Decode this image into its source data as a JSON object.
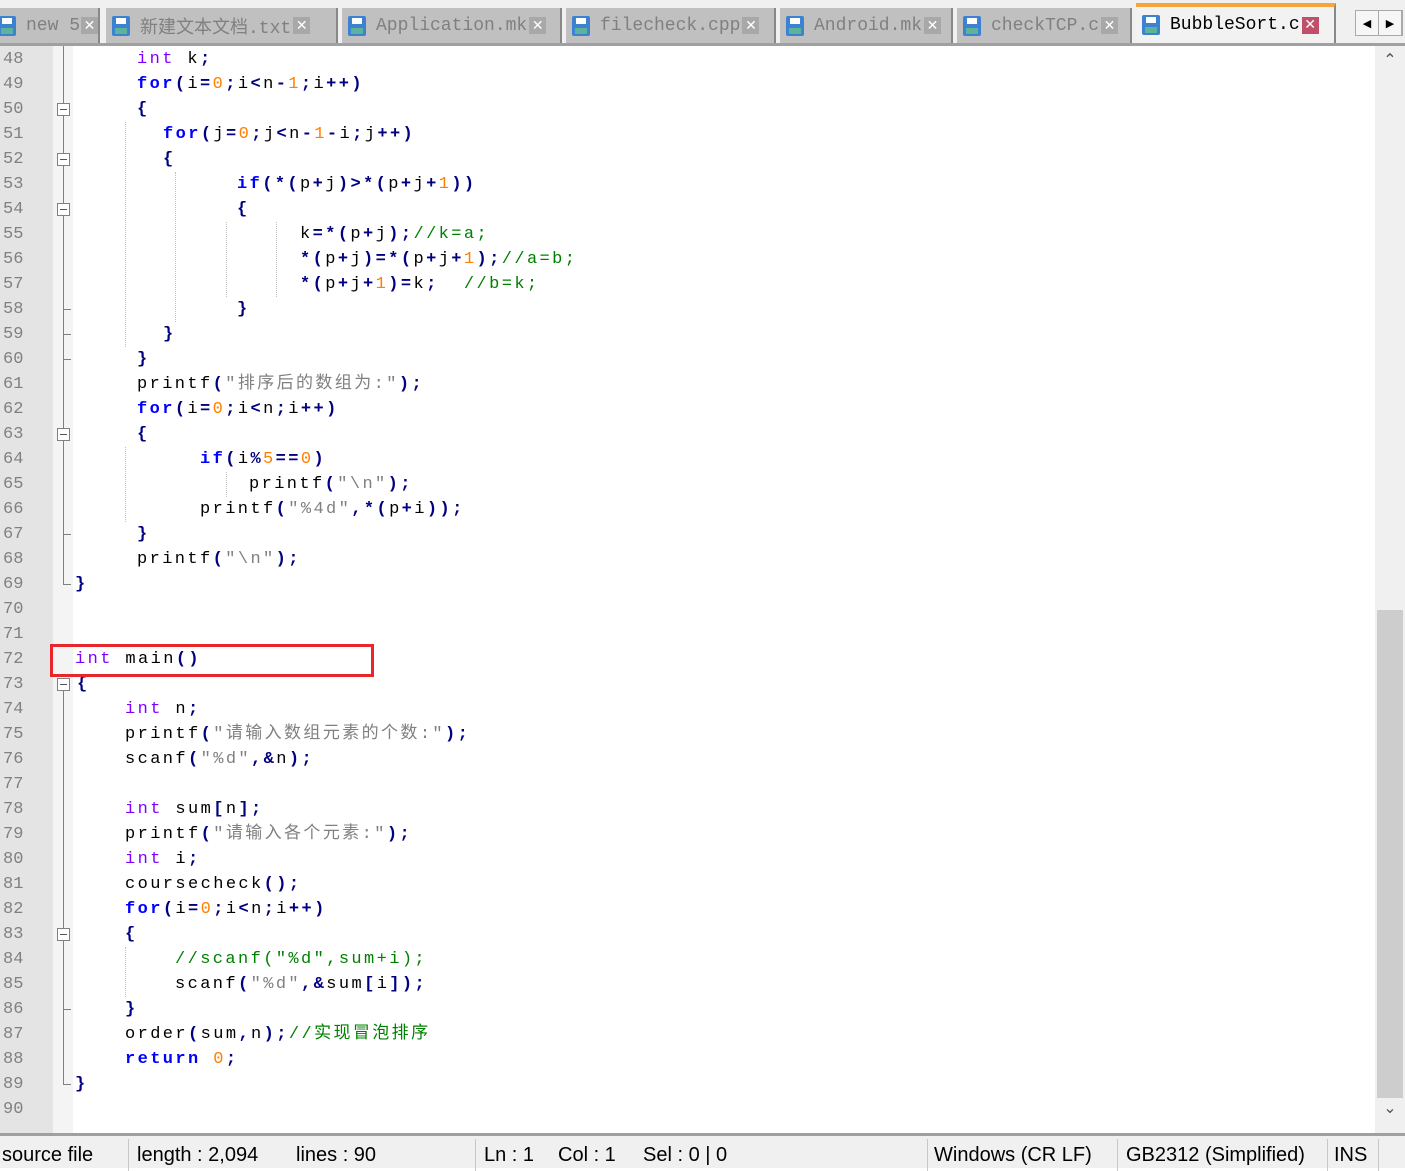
{
  "tabs": [
    {
      "label": "new 5",
      "active": false
    },
    {
      "label": "新建文本文档.txt",
      "active": false
    },
    {
      "label": "Application.mk",
      "active": false
    },
    {
      "label": "filecheck.cpp",
      "active": false
    },
    {
      "label": "Android.mk",
      "active": false
    },
    {
      "label": "checkTCP.c",
      "active": false
    },
    {
      "label": "BubbleSort.c",
      "active": true
    }
  ],
  "tab_nav": {
    "prev": "◀",
    "next": "▶"
  },
  "editor": {
    "first_line": 48,
    "highlighted_line": 72,
    "highlight_color": "#e8262b",
    "lines": [
      [
        [
          "ty",
          "int"
        ],
        [
          "id",
          " k"
        ],
        [
          "op",
          ";"
        ]
      ],
      [
        [
          "kw",
          "for"
        ],
        [
          "op",
          "("
        ],
        [
          "id",
          "i"
        ],
        [
          "op",
          "="
        ],
        [
          "nm",
          "0"
        ],
        [
          "op",
          ";"
        ],
        [
          "id",
          "i"
        ],
        [
          "op",
          "<"
        ],
        [
          "id",
          "n"
        ],
        [
          "op",
          "-"
        ],
        [
          "nm",
          "1"
        ],
        [
          "op",
          ";"
        ],
        [
          "id",
          "i"
        ],
        [
          "op",
          "++)"
        ]
      ],
      [
        [
          "op",
          "{"
        ]
      ],
      [
        [
          "kw",
          "for"
        ],
        [
          "op",
          "("
        ],
        [
          "id",
          "j"
        ],
        [
          "op",
          "="
        ],
        [
          "nm",
          "0"
        ],
        [
          "op",
          ";"
        ],
        [
          "id",
          "j"
        ],
        [
          "op",
          "<"
        ],
        [
          "id",
          "n"
        ],
        [
          "op",
          "-"
        ],
        [
          "nm",
          "1"
        ],
        [
          "op",
          "-"
        ],
        [
          "id",
          "i"
        ],
        [
          "op",
          ";"
        ],
        [
          "id",
          "j"
        ],
        [
          "op",
          "++)"
        ]
      ],
      [
        [
          "op",
          "{"
        ]
      ],
      [
        [
          "kw",
          "if"
        ],
        [
          "op",
          "(*("
        ],
        [
          "id",
          "p"
        ],
        [
          "op",
          "+"
        ],
        [
          "id",
          "j"
        ],
        [
          "op",
          ")>*("
        ],
        [
          "id",
          "p"
        ],
        [
          "op",
          "+"
        ],
        [
          "id",
          "j"
        ],
        [
          "op",
          "+"
        ],
        [
          "nm",
          "1"
        ],
        [
          "op",
          "))"
        ]
      ],
      [
        [
          "op",
          "{"
        ]
      ],
      [
        [
          "id",
          "k"
        ],
        [
          "op",
          "=*("
        ],
        [
          "id",
          "p"
        ],
        [
          "op",
          "+"
        ],
        [
          "id",
          "j"
        ],
        [
          "op",
          ");"
        ],
        [
          "cm",
          "//k=a;"
        ]
      ],
      [
        [
          "op",
          "*("
        ],
        [
          "id",
          "p"
        ],
        [
          "op",
          "+"
        ],
        [
          "id",
          "j"
        ],
        [
          "op",
          ")=*("
        ],
        [
          "id",
          "p"
        ],
        [
          "op",
          "+"
        ],
        [
          "id",
          "j"
        ],
        [
          "op",
          "+"
        ],
        [
          "nm",
          "1"
        ],
        [
          "op",
          ");"
        ],
        [
          "cm",
          "//a=b;"
        ]
      ],
      [
        [
          "op",
          "*("
        ],
        [
          "id",
          "p"
        ],
        [
          "op",
          "+"
        ],
        [
          "id",
          "j"
        ],
        [
          "op",
          "+"
        ],
        [
          "nm",
          "1"
        ],
        [
          "op",
          ")="
        ],
        [
          "id",
          "k"
        ],
        [
          "op",
          ";"
        ],
        [
          "id",
          "  "
        ],
        [
          "cm",
          "//b=k;"
        ]
      ],
      [
        [
          "op",
          "}"
        ]
      ],
      [
        [
          "op",
          "}"
        ]
      ],
      [
        [
          "op",
          "}"
        ]
      ],
      [
        [
          "id",
          "printf"
        ],
        [
          "op",
          "("
        ],
        [
          "st",
          "\"排序后的数组为:\""
        ],
        [
          "op",
          ");"
        ]
      ],
      [
        [
          "kw",
          "for"
        ],
        [
          "op",
          "("
        ],
        [
          "id",
          "i"
        ],
        [
          "op",
          "="
        ],
        [
          "nm",
          "0"
        ],
        [
          "op",
          ";"
        ],
        [
          "id",
          "i"
        ],
        [
          "op",
          "<"
        ],
        [
          "id",
          "n"
        ],
        [
          "op",
          ";"
        ],
        [
          "id",
          "i"
        ],
        [
          "op",
          "++)"
        ]
      ],
      [
        [
          "op",
          "{"
        ]
      ],
      [
        [
          "kw",
          "if"
        ],
        [
          "op",
          "("
        ],
        [
          "id",
          "i"
        ],
        [
          "op",
          "%"
        ],
        [
          "nm",
          "5"
        ],
        [
          "op",
          "=="
        ],
        [
          "nm",
          "0"
        ],
        [
          "op",
          ")"
        ]
      ],
      [
        [
          "id",
          "printf"
        ],
        [
          "op",
          "("
        ],
        [
          "st",
          "\"\\n\""
        ],
        [
          "op",
          ");"
        ]
      ],
      [
        [
          "id",
          "printf"
        ],
        [
          "op",
          "("
        ],
        [
          "st",
          "\"%4d\""
        ],
        [
          "op",
          ",*("
        ],
        [
          "id",
          "p"
        ],
        [
          "op",
          "+"
        ],
        [
          "id",
          "i"
        ],
        [
          "op",
          "));"
        ]
      ],
      [
        [
          "op",
          "}"
        ]
      ],
      [
        [
          "id",
          "printf"
        ],
        [
          "op",
          "("
        ],
        [
          "st",
          "\"\\n\""
        ],
        [
          "op",
          ");"
        ]
      ],
      [
        [
          "op",
          "}"
        ]
      ],
      [],
      [],
      [
        [
          "ty",
          "int"
        ],
        [
          "id",
          " main"
        ],
        [
          "op",
          "()"
        ]
      ],
      [
        [
          "op",
          "{"
        ]
      ],
      [
        [
          "ty",
          "int"
        ],
        [
          "id",
          " n"
        ],
        [
          "op",
          ";"
        ]
      ],
      [
        [
          "id",
          "printf"
        ],
        [
          "op",
          "("
        ],
        [
          "st",
          "\"请输入数组元素的个数:\""
        ],
        [
          "op",
          ");"
        ]
      ],
      [
        [
          "id",
          "scanf"
        ],
        [
          "op",
          "("
        ],
        [
          "st",
          "\"%d\""
        ],
        [
          "op",
          ",&"
        ],
        [
          "id",
          "n"
        ],
        [
          "op",
          ");"
        ]
      ],
      [],
      [
        [
          "ty",
          "int"
        ],
        [
          "id",
          " sum"
        ],
        [
          "op",
          "["
        ],
        [
          "id",
          "n"
        ],
        [
          "op",
          "];"
        ]
      ],
      [
        [
          "id",
          "printf"
        ],
        [
          "op",
          "("
        ],
        [
          "st",
          "\"请输入各个元素:\""
        ],
        [
          "op",
          ");"
        ]
      ],
      [
        [
          "ty",
          "int"
        ],
        [
          "id",
          " i"
        ],
        [
          "op",
          ";"
        ]
      ],
      [
        [
          "id",
          "coursecheck"
        ],
        [
          "op",
          "();"
        ]
      ],
      [
        [
          "kw",
          "for"
        ],
        [
          "op",
          "("
        ],
        [
          "id",
          "i"
        ],
        [
          "op",
          "="
        ],
        [
          "nm",
          "0"
        ],
        [
          "op",
          ";"
        ],
        [
          "id",
          "i"
        ],
        [
          "op",
          "<"
        ],
        [
          "id",
          "n"
        ],
        [
          "op",
          ";"
        ],
        [
          "id",
          "i"
        ],
        [
          "op",
          "++)"
        ]
      ],
      [
        [
          "op",
          "{"
        ]
      ],
      [
        [
          "cm",
          "//scanf(\"%d\",sum+i);"
        ]
      ],
      [
        [
          "id",
          "scanf"
        ],
        [
          "op",
          "("
        ],
        [
          "st",
          "\"%d\""
        ],
        [
          "op",
          ",&"
        ],
        [
          "id",
          "sum"
        ],
        [
          "op",
          "["
        ],
        [
          "id",
          "i"
        ],
        [
          "op",
          "]);"
        ]
      ],
      [
        [
          "op",
          "}"
        ]
      ],
      [
        [
          "id",
          "order"
        ],
        [
          "op",
          "("
        ],
        [
          "id",
          "sum"
        ],
        [
          "op",
          ","
        ],
        [
          "id",
          "n"
        ],
        [
          "op",
          ");"
        ],
        [
          "cm",
          "//实现冒泡排序"
        ]
      ],
      [
        [
          "kw",
          "return"
        ],
        [
          "id",
          " "
        ],
        [
          "nm",
          "0"
        ],
        [
          "op",
          ";"
        ]
      ],
      [
        [
          "op",
          "}"
        ]
      ],
      []
    ]
  },
  "scrollbar": {
    "up": "⌃",
    "down": "⌄",
    "position_fraction": 0.55
  },
  "status": {
    "file_type": "source file",
    "length": "length : 2,094",
    "lines": "lines : 90",
    "ln": "Ln : 1",
    "col": "Col : 1",
    "sel": "Sel : 0 | 0",
    "eol": "Windows (CR LF)",
    "encoding": "GB2312 (Simplified)",
    "mode": "INS"
  }
}
